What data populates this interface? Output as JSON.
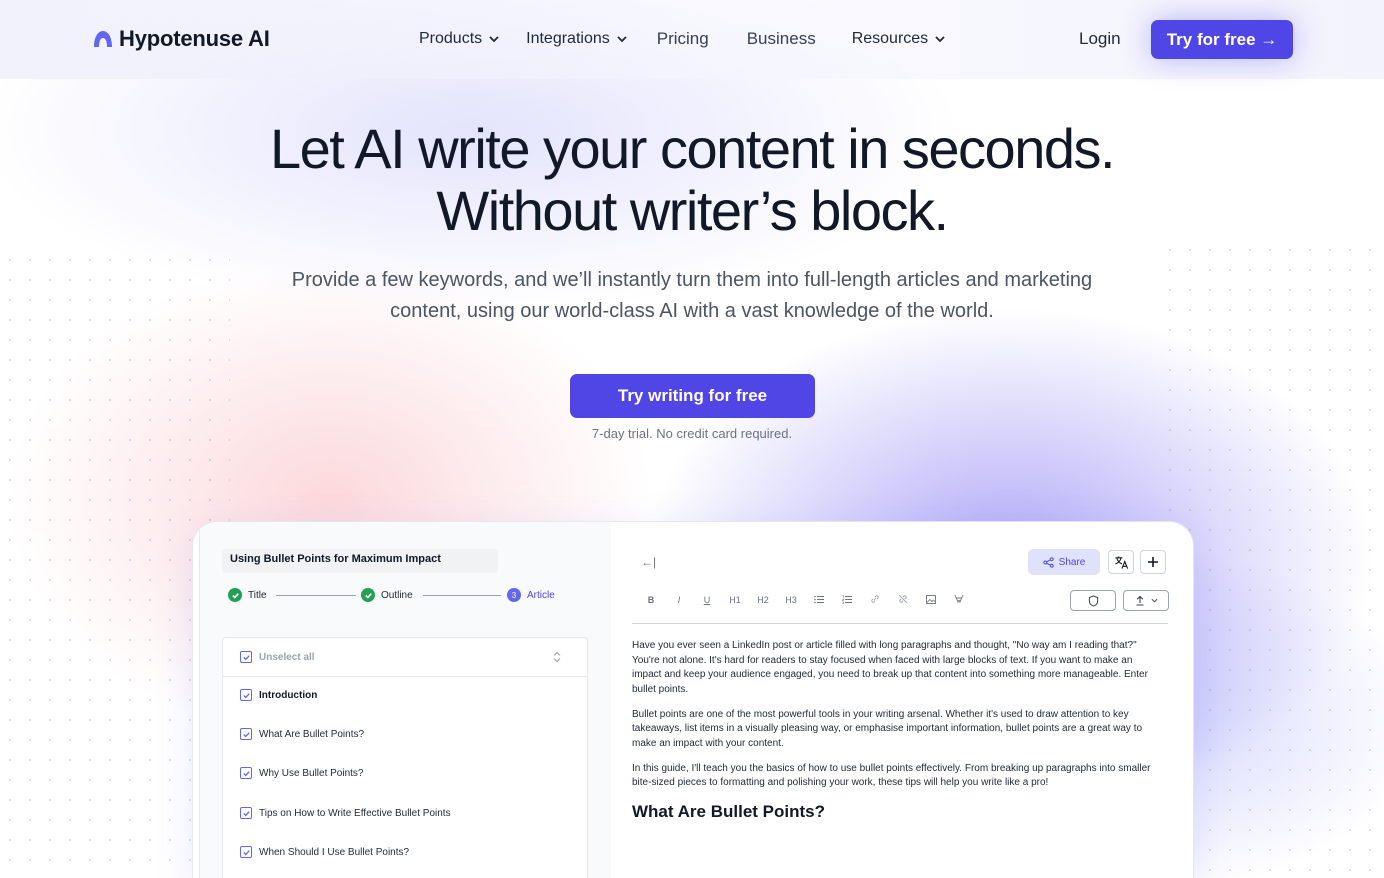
{
  "nav": {
    "logo_text": "Hypotenuse AI",
    "menu": [
      {
        "label": "Products",
        "dropdown": true
      },
      {
        "label": "Integrations",
        "dropdown": true
      },
      {
        "label": "Pricing",
        "dropdown": false
      },
      {
        "label": "Business",
        "dropdown": false
      },
      {
        "label": "Resources",
        "dropdown": true
      }
    ],
    "login_label": "Login",
    "cta_label": "Try for free →"
  },
  "hero": {
    "title_line1": "Let AI write your content in seconds.",
    "title_line2": "Without writer’s block.",
    "subtitle_line1": "Provide a few keywords, and we’ll instantly turn them into full-length articles and marketing",
    "subtitle_line2": "content, using our world-class AI with a vast knowledge of the world.",
    "cta_label": "Try writing for free",
    "trial_note": "7-day trial. No credit card required."
  },
  "app": {
    "doc_title": "Using Bullet Points for Maximum Impact",
    "steps": [
      {
        "label": "Title",
        "state": "done"
      },
      {
        "label": "Outline",
        "state": "done"
      },
      {
        "label": "Article",
        "state": "active",
        "number": "3"
      }
    ],
    "outline": {
      "unselect_label": "Unselect all",
      "items": [
        {
          "label": "Introduction",
          "bold": true
        },
        {
          "label": "What Are Bullet Points?",
          "bold": false
        },
        {
          "label": "Why Use Bullet Points?",
          "bold": false
        },
        {
          "label": "Tips on How to Write Effective Bullet Points",
          "bold": false
        },
        {
          "label": "When Should I Use Bullet Points?",
          "bold": false
        }
      ]
    },
    "editor": {
      "back_glyph": "←|",
      "share_label": "Share",
      "toolbar": [
        "B",
        "I",
        "U",
        "H1",
        "H2",
        "H3",
        "bullet-list-icon",
        "numbered-list-icon",
        "link-icon",
        "unlink-icon",
        "image-icon",
        "clear-format-icon"
      ],
      "paragraphs": [
        "Have you ever seen a LinkedIn post or article filled with long paragraphs and thought, \"No way am I reading that?\" You're not alone. It's hard for readers to stay focused when faced with large blocks of text. If you want to make an impact and keep your audience engaged, you need to break up that content into something more manageable. Enter bullet points.",
        "Bullet points are one of the most powerful tools in your writing arsenal. Whether it's used to draw attention to key takeaways, list items in a visually pleasing way, or emphasise important information, bullet points are a great way to make an impact with your content.",
        "In this guide, I'll teach you the basics of how to use bullet points effectively. From breaking up paragraphs into smaller bite-sized pieces to formatting and polishing your work, these tips will help you write like a pro!"
      ],
      "heading": "What Are Bullet Points?"
    }
  },
  "colors": {
    "accent": "#4f46e5",
    "success": "#22a056"
  }
}
